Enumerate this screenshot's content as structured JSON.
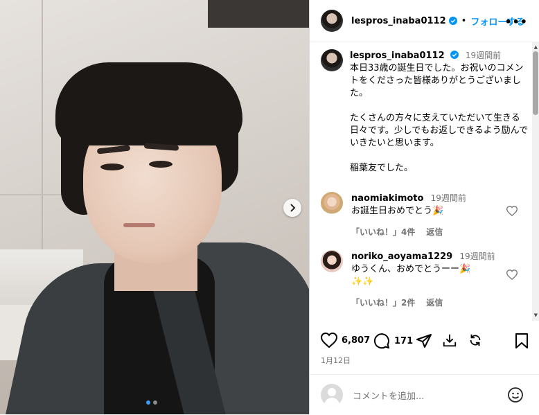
{
  "header": {
    "username": "lespros_inaba0112",
    "separator": "•",
    "follow_label": "フォローする",
    "more_label": "•••"
  },
  "caption": {
    "username": "lespros_inaba0112",
    "time": "19週間前",
    "text": "本日33歳の誕生日でした。お祝いのコメントをくださった皆様ありがとうございました。\n\nたくさんの方々に支えていただいて生きる日々です。少しでもお返しできるよう励んでいきたいと思います。\n\n稲葉友でした。"
  },
  "comments": [
    {
      "username": "naomiakimoto",
      "time": "19週間前",
      "text": "お誕生日おめでとう🎉",
      "likes": "「いいね！」4件",
      "reply": "返信"
    },
    {
      "username": "noriko_aoyama1229",
      "time": "19週間前",
      "text": "ゆうくん、おめでとうーー🎉\n✨✨",
      "likes": "「いいね！」2件",
      "reply": "返信"
    }
  ],
  "actions": {
    "like_count": "6,807",
    "comment_count": "171"
  },
  "post_date": "1月12日",
  "add_comment": {
    "placeholder": "コメントを追加..."
  },
  "carousel": {
    "current": 1,
    "total": 2
  },
  "colors": {
    "accent": "#0095f6",
    "verified": "#0095f6",
    "muted": "#737373"
  }
}
